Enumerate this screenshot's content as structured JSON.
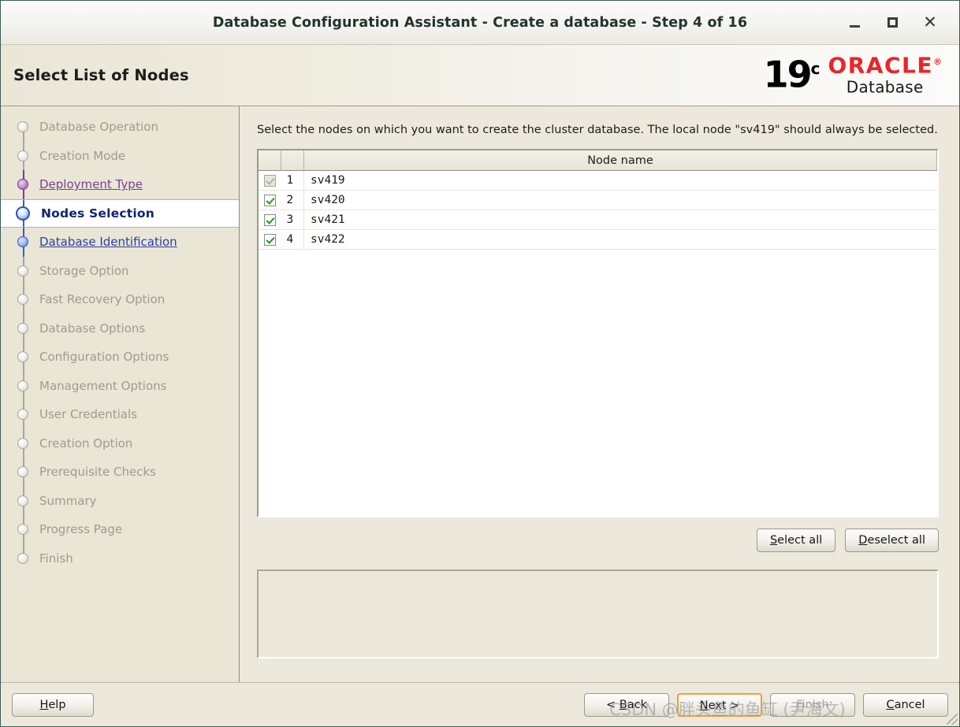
{
  "window": {
    "title": "Database Configuration Assistant - Create a database - Step 4 of 16",
    "minimize_label": "–",
    "maximize_label": "□",
    "close_label": "✕"
  },
  "header": {
    "page_title": "Select List of Nodes",
    "logo": {
      "version": "19",
      "version_sup": "c",
      "brand": "ORACLE",
      "registered": "®",
      "product": "Database"
    }
  },
  "sidebar": {
    "items": [
      {
        "label": "Database Operation",
        "state": "pending"
      },
      {
        "label": "Creation Mode",
        "state": "pending"
      },
      {
        "label": "Deployment Type",
        "state": "visited"
      },
      {
        "label": "Nodes Selection",
        "state": "current"
      },
      {
        "label": "Database Identification",
        "state": "visited-blue"
      },
      {
        "label": "Storage Option",
        "state": "pending"
      },
      {
        "label": "Fast Recovery Option",
        "state": "pending"
      },
      {
        "label": "Database Options",
        "state": "pending"
      },
      {
        "label": "Configuration Options",
        "state": "pending"
      },
      {
        "label": "Management Options",
        "state": "pending"
      },
      {
        "label": "User Credentials",
        "state": "pending"
      },
      {
        "label": "Creation Option",
        "state": "pending"
      },
      {
        "label": "Prerequisite Checks",
        "state": "pending"
      },
      {
        "label": "Summary",
        "state": "pending"
      },
      {
        "label": "Progress Page",
        "state": "pending"
      },
      {
        "label": "Finish",
        "state": "pending"
      }
    ]
  },
  "main": {
    "instruction": "Select the nodes on which you want to create the cluster database. The local node \"sv419\" should always be selected.",
    "table": {
      "columns": [
        "",
        "",
        "Node name"
      ],
      "header_node_name": "Node name",
      "rows": [
        {
          "index": "1",
          "name": "sv419",
          "checked": true,
          "enabled": false
        },
        {
          "index": "2",
          "name": "sv420",
          "checked": true,
          "enabled": true
        },
        {
          "index": "3",
          "name": "sv421",
          "checked": true,
          "enabled": true
        },
        {
          "index": "4",
          "name": "sv422",
          "checked": true,
          "enabled": true
        }
      ]
    },
    "select_all_label": "Select all",
    "select_all_mnemonic": "S",
    "deselect_all_label": "Deselect all",
    "deselect_all_mnemonic": "D",
    "message_panel_text": ""
  },
  "footer": {
    "help_label": "Help",
    "help_mnemonic": "H",
    "back_label": "< Back",
    "back_mnemonic": "B",
    "next_label": "Next >",
    "next_mnemonic": "N",
    "finish_label": "Finish",
    "finish_mnemonic": "F",
    "cancel_label": "Cancel",
    "cancel_mnemonic": "C"
  },
  "overlay": {
    "watermark": "CSDN @胖头鱼的鱼缸 (尹海文)"
  },
  "colors": {
    "background": "#ece9dc",
    "sidebar": "#e9e6d6",
    "oracle_red": "#e8262b",
    "current_step_text": "#12246e",
    "visited_step_text": "#7b3f93",
    "link_blue": "#2a3fa8",
    "check_green": "#1f9b22",
    "focus_orange": "#e9a23b"
  }
}
